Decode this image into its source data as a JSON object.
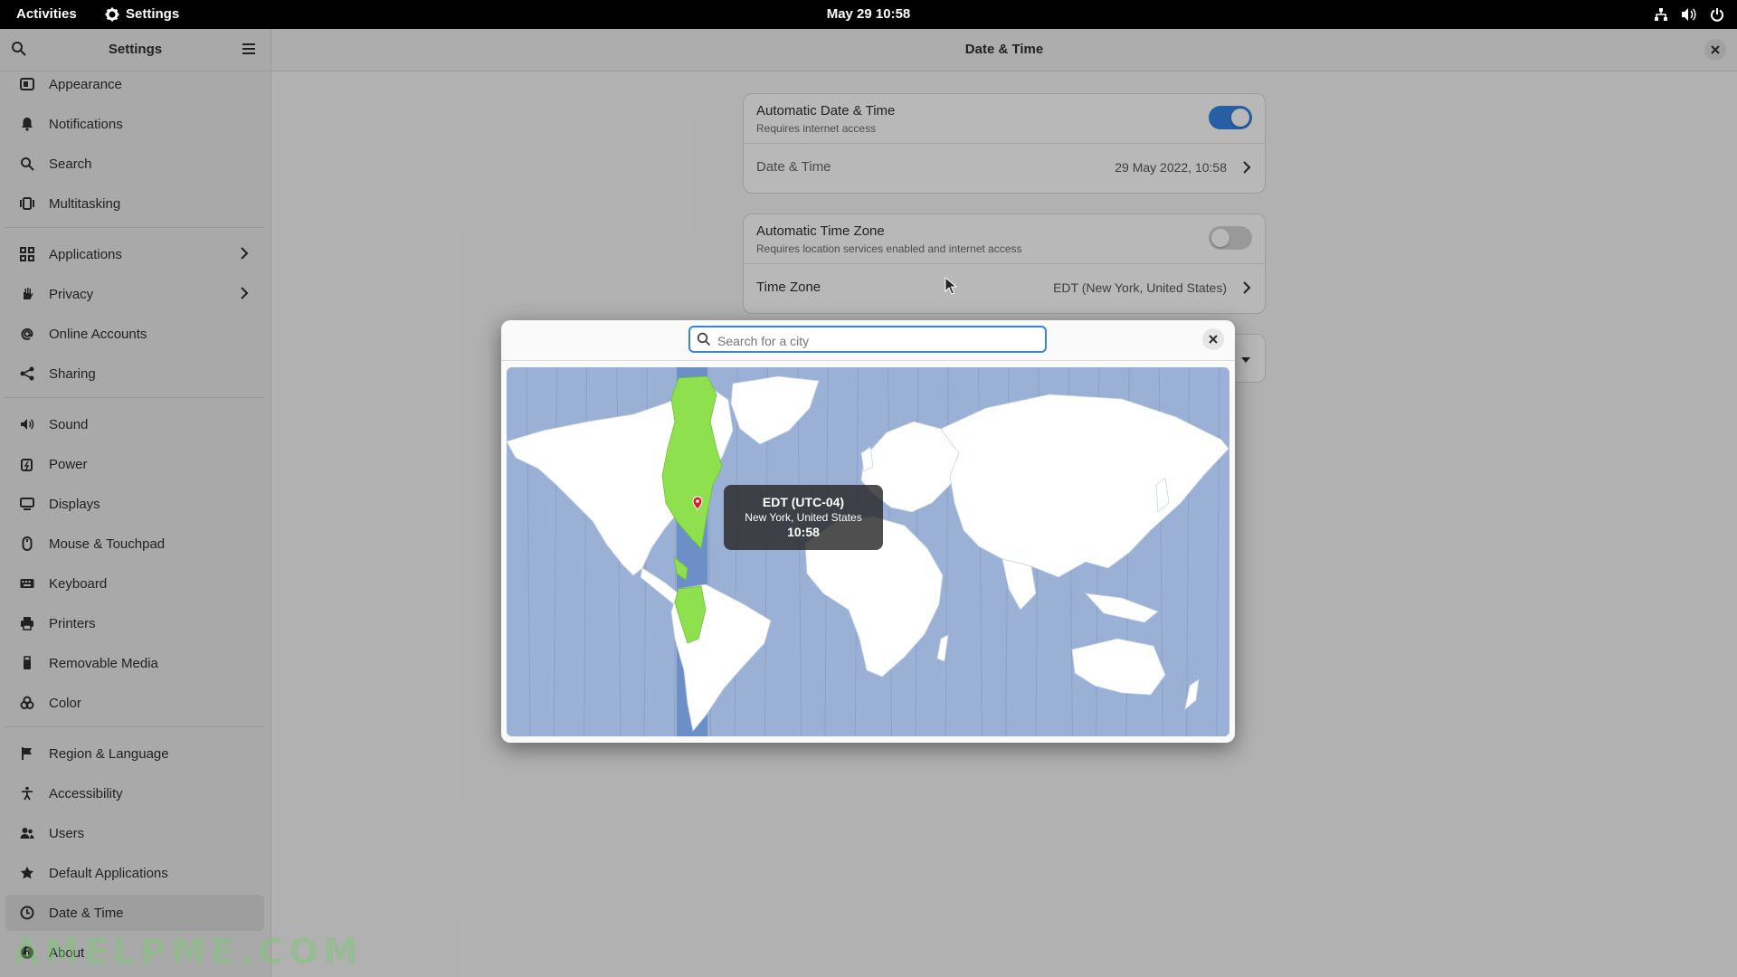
{
  "topbar": {
    "activities": "Activities",
    "app_name": "Settings",
    "clock": "May 29  10:58"
  },
  "sidebar": {
    "title": "Settings",
    "items": [
      {
        "label": "Appearance",
        "icon": "appearance-icon"
      },
      {
        "label": "Notifications",
        "icon": "bell-icon"
      },
      {
        "label": "Search",
        "icon": "search-icon"
      },
      {
        "label": "Multitasking",
        "icon": "multitasking-icon"
      },
      {
        "label": "Applications",
        "icon": "applications-icon",
        "arrow": true
      },
      {
        "label": "Privacy",
        "icon": "hand-icon",
        "arrow": true
      },
      {
        "label": "Online Accounts",
        "icon": "at-icon"
      },
      {
        "label": "Sharing",
        "icon": "share-icon"
      },
      {
        "label": "Sound",
        "icon": "speaker-icon"
      },
      {
        "label": "Power",
        "icon": "power-icon"
      },
      {
        "label": "Displays",
        "icon": "display-icon"
      },
      {
        "label": "Mouse & Touchpad",
        "icon": "mouse-icon"
      },
      {
        "label": "Keyboard",
        "icon": "keyboard-icon"
      },
      {
        "label": "Printers",
        "icon": "printer-icon"
      },
      {
        "label": "Removable Media",
        "icon": "usb-icon"
      },
      {
        "label": "Color",
        "icon": "color-icon"
      },
      {
        "label": "Region & Language",
        "icon": "flag-icon"
      },
      {
        "label": "Accessibility",
        "icon": "accessibility-icon"
      },
      {
        "label": "Users",
        "icon": "users-icon"
      },
      {
        "label": "Default Applications",
        "icon": "star-icon"
      },
      {
        "label": "Date & Time",
        "icon": "clock-icon",
        "selected": true
      },
      {
        "label": "About",
        "icon": "info-icon"
      }
    ]
  },
  "main": {
    "title": "Date & Time",
    "auto_datetime": {
      "label": "Automatic Date & Time",
      "sub": "Requires internet access",
      "on": true
    },
    "datetime": {
      "label": "Date & Time",
      "value": "29 May 2022, 10:58"
    },
    "auto_timezone": {
      "label": "Automatic Time Zone",
      "sub": "Requires location services enabled and internet access",
      "on": false
    },
    "timezone": {
      "label": "Time Zone",
      "value": "EDT (New York, United States)"
    }
  },
  "dialog": {
    "search_placeholder": "Search for a city",
    "tooltip": {
      "zone": "EDT (UTC-04)",
      "city": "New York, United States",
      "time": "10:58"
    }
  },
  "colors": {
    "accent": "#3584e4",
    "ocean": "#9ab0d4",
    "highlight_zone": "#8ee04e"
  },
  "watermark": "AMELPME.COM"
}
